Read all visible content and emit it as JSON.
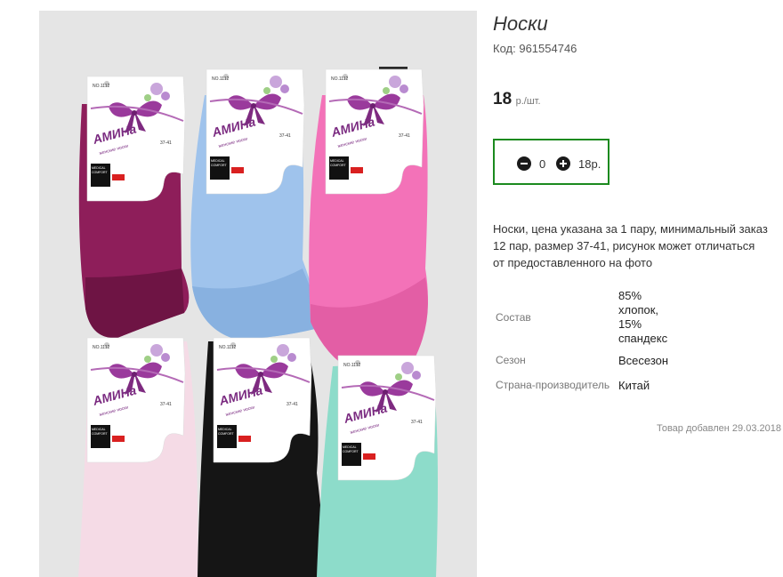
{
  "product": {
    "title": "Носки",
    "code_label": "Код:",
    "code_value": "961554746",
    "price": "18",
    "price_unit": "р./шт.",
    "quantity": "0",
    "total": "18р.",
    "description": "Носки, цена указана за 1 пару, минимальный заказ 12 пар, размер 37-41, рисунок может отличаться от предоставленного на фото",
    "attributes": [
      {
        "label": "Состав",
        "value": "85% хлопок, 15% спандекс"
      },
      {
        "label": "Сезон",
        "value": "Всесезон"
      },
      {
        "label": "Страна-производитель",
        "value": "Китай"
      }
    ],
    "added": "Товар добавлен 29.03.2018"
  },
  "photo": {
    "brand": "АМИНа",
    "subtitle": "женские носки",
    "size": "37-41",
    "model": "NO.1112",
    "badge_line1": "MEDICAL",
    "badge_line2": "COMFORT",
    "sock_colors": [
      "#8e1e5a",
      "#9fc3ec",
      "#f372b8",
      "#f5dbe6",
      "#151515",
      "#8ddcca"
    ]
  }
}
